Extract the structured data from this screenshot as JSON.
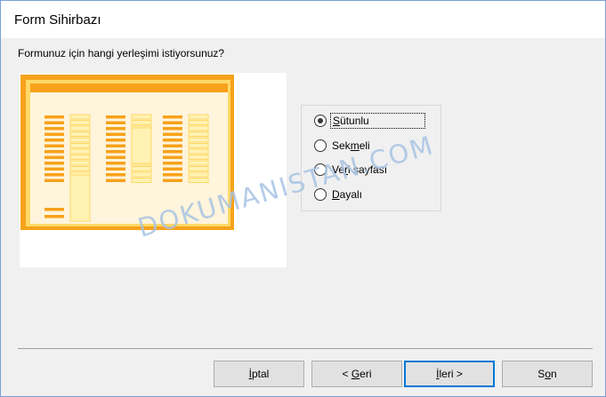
{
  "window": {
    "title": "Form Sihirbazı"
  },
  "prompt": "Formunuz için hangi yerleşimi istiyorsunuz?",
  "layout_options": [
    {
      "pre": "",
      "ul": "S",
      "post": "ütunlu",
      "selected": true
    },
    {
      "pre": "Sek",
      "ul": "m",
      "post": "eli",
      "selected": false
    },
    {
      "pre": "Ve",
      "ul": "r",
      "post": "i sayfası",
      "selected": false
    },
    {
      "pre": "",
      "ul": "D",
      "post": "ayalı",
      "selected": false
    }
  ],
  "buttons": {
    "cancel": {
      "pre": "",
      "ul": "İ",
      "post": "ptal"
    },
    "back": {
      "pre": "< ",
      "ul": "G",
      "post": "eri"
    },
    "next": {
      "pre": "",
      "ul": "İ",
      "post": "leri >"
    },
    "finish": {
      "pre": "S",
      "ul": "o",
      "post": "n"
    }
  },
  "watermark": "DOKUMANISTAN.COM",
  "colors": {
    "accent": "#0078d7",
    "preview_orange": "#f7a21b",
    "preview_yellow": "#ffd966",
    "preview_bg": "#fff4dc"
  }
}
